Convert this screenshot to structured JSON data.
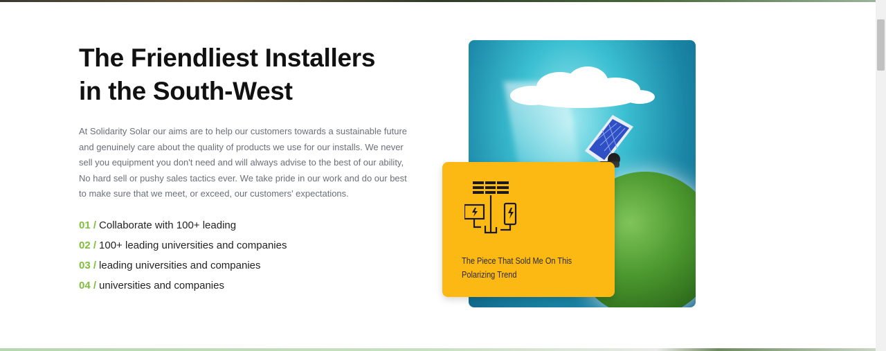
{
  "section": {
    "heading_line1": "The Friendliest Installers",
    "heading_line2": "in the South-West",
    "intro": "At Solidarity Solar our aims are to help our customers towards a sustainable future and genuinely care about the quality of products we use for our installs. We never sell you equipment you don't need and will always advise to the best of our ability, No hard sell or pushy sales tactics ever. We take pride in our work and do our best to make sure that we meet, or exceed, our customers' expectations.",
    "features": [
      {
        "num": "01 /",
        "text": "Collaborate with 100+ leading"
      },
      {
        "num": "02 /",
        "text": "100+ leading universities and companies"
      },
      {
        "num": "03 /",
        "text": "leading universities and companies"
      },
      {
        "num": "04 /",
        "text": "universities and companies"
      }
    ]
  },
  "promo_card": {
    "text": "The Piece That Sold Me On This Polarizing Trend",
    "icon": "solar-energy-icon"
  },
  "hero_image": {
    "icon": "solar-globe-image"
  },
  "colors": {
    "accent_green": "#7fbf3b",
    "card_yellow": "#fdb913",
    "heading": "#111111",
    "body_text": "#6b6f78"
  }
}
